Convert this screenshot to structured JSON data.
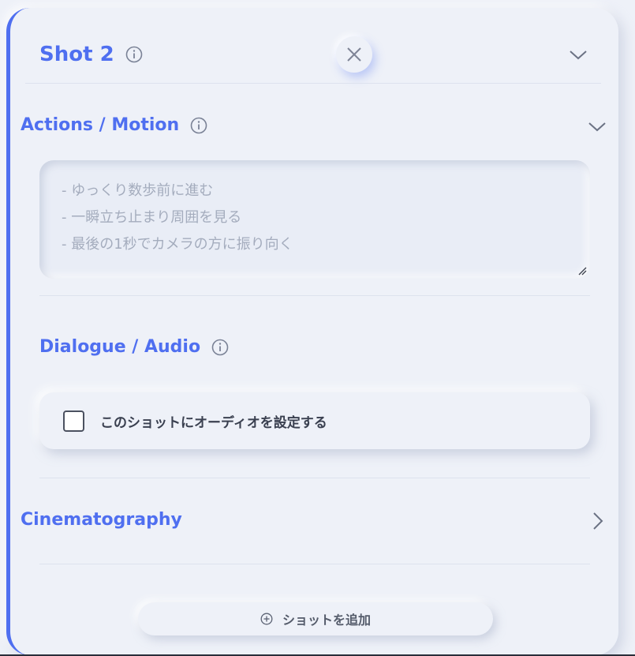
{
  "shot": {
    "title": "Shot 2",
    "info_icon": "info-icon",
    "collapse_icon": "chevron-down-icon",
    "close_icon": "close-icon"
  },
  "actions": {
    "heading": "Actions / Motion",
    "placeholder": "- ゆっくり数歩前に進む\n- 一瞬立ち止まり周囲を見る\n- 最後の1秒でカメラの方に振り向く",
    "value": ""
  },
  "dialogue": {
    "heading": "Dialogue / Audio",
    "checkbox_label": "このショットにオーディオを設定する",
    "checked": false
  },
  "cinematography": {
    "heading": "Cinematography",
    "expand_icon": "chevron-right-icon"
  },
  "add_shot": {
    "label": "ショットを追加",
    "icon": "plus-circle-icon"
  },
  "colors": {
    "accent": "#4f6ff0",
    "background": "#eef1f8",
    "muted_text": "#a4acbd"
  }
}
